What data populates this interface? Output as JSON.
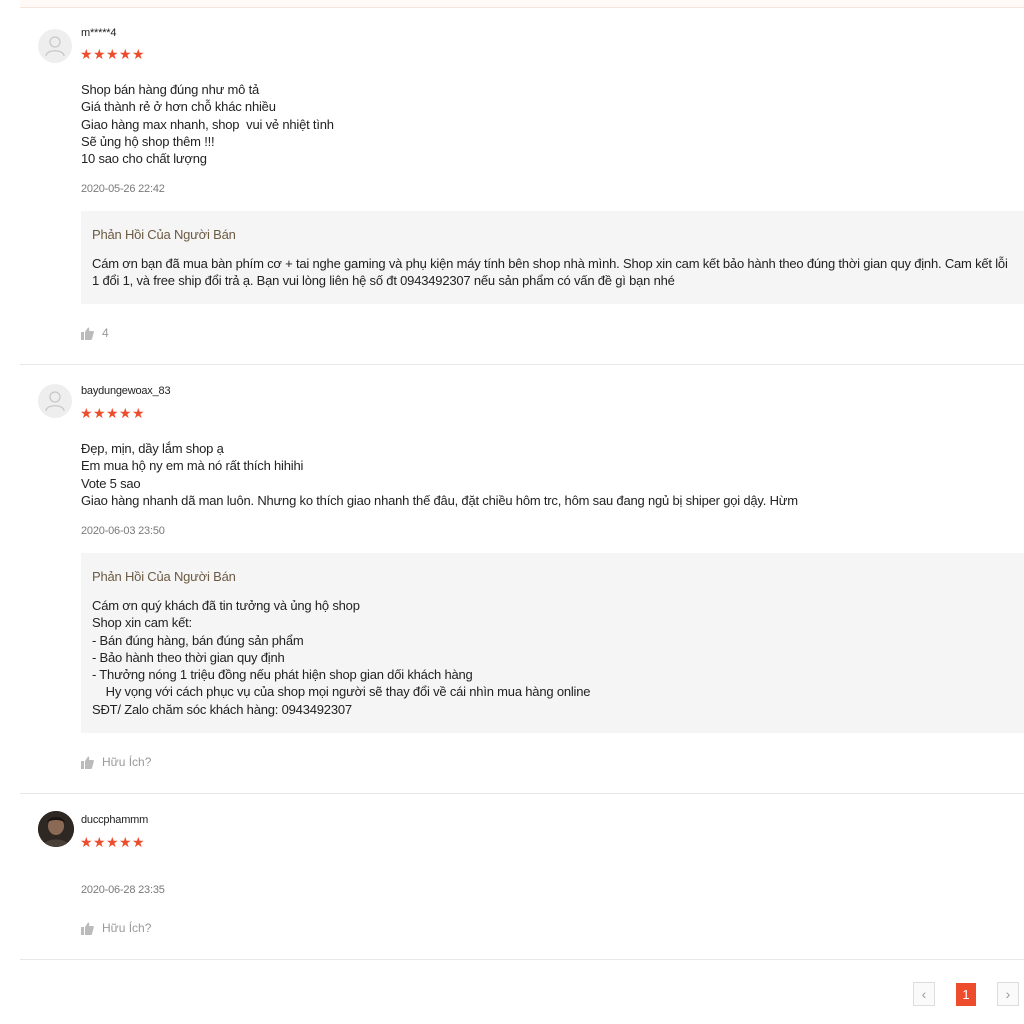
{
  "reviews": [
    {
      "username": "m*****4",
      "stars": [
        "★",
        "★",
        "★",
        "★",
        "★"
      ],
      "comment": "Shop bán hàng đúng như mô tả\nGiá thành rẻ ở hơn chỗ khác nhiều\nGiao hàng max nhanh, shop  vui vẻ nhiệt tình\nSẽ ủng hộ shop thêm !!!\n10 sao cho chất lượng",
      "time": "2020-05-26 22:42",
      "reply_title": "Phản Hồi Của Người Bán",
      "reply_text": "Cám ơn bạn đã mua bàn phím cơ + tai nghe gaming và phụ kiện máy tính  bên shop nhà mình. Shop xin cam kết bảo hành theo đúng thời gian quy định. Cam kết lỗi 1 đổi 1, và free ship đổi trả ạ. Bạn vui lòng liên hệ số đt 0943492307 nếu sản phẩm có vấn đề gì bạn nhé",
      "like_label": "4"
    },
    {
      "username": "baydungewoax_83",
      "stars": [
        "★",
        "★",
        "★",
        "★",
        "★"
      ],
      "comment": "Đẹp, mịn, dầy lắm shop ạ\nEm mua hộ ny em mà nó rất thích hihihi\nVote 5 sao\nGiao hàng nhanh dã man luôn. Nhưng ko thích giao nhanh thế đâu, đặt chiều hôm trc, hôm sau đang ngủ bị shiper gọi dậy. Hừm",
      "time": "2020-06-03 23:50",
      "reply_title": "Phản Hồi Của Người Bán",
      "reply_text": "Cám ơn quý khách đã tin tưởng và ủng hộ shop\nShop xin cam kết:\n- Bán đúng hàng, bán đúng sản phẩm\n- Bảo hành theo thời gian quy định\n- Thưởng nóng 1 triệu đồng nếu phát hiện shop gian dối khách hàng\n    Hy vọng với cách phục vụ của shop mọi người sẽ thay đổi về cái nhìn mua hàng online\nSĐT/ Zalo chăm sóc khách hàng: 0943492307",
      "like_label": "Hữu Ích?"
    },
    {
      "username": "duccphammm",
      "stars": [
        "★",
        "★",
        "★",
        "★",
        "★"
      ],
      "time": "2020-06-28 23:35",
      "like_label": "Hữu Ích?"
    }
  ],
  "pagination": {
    "prev": "‹",
    "current": "1",
    "next": "›"
  },
  "colors": {
    "accent": "#ee4d2d",
    "reply_title": "#6b5a43",
    "reply_bg": "#f5f5f5"
  },
  "icons": {
    "avatar": "user-silhouette-icon",
    "like": "thumbs-up-icon"
  }
}
